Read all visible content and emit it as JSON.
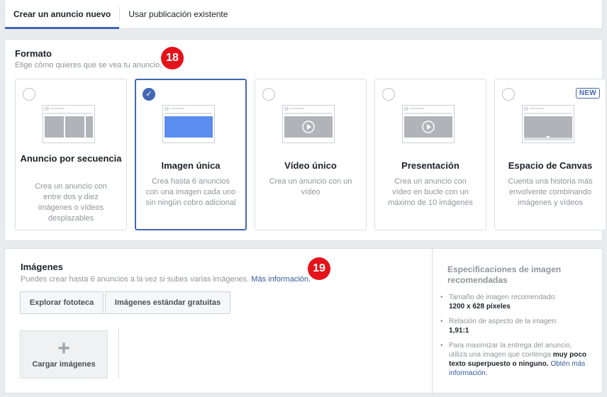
{
  "tabs": [
    {
      "label": "Crear un anuncio nuevo",
      "active": true
    },
    {
      "label": "Usar publicación existente",
      "active": false
    }
  ],
  "format": {
    "title": "Formato",
    "subtitle": "Elige cómo quieres que se vea tu anuncio.",
    "badge": "18",
    "cards": [
      {
        "title": "Anuncio por secuencia",
        "desc": "Crea un anuncio con entre dos y diez imágenes o vídeos desplazables",
        "selected": false,
        "icon": "carousel-thumbnail-icon"
      },
      {
        "title": "Imagen única",
        "desc": "Crea hasta 6 anuncios con una imagen cada uno sin ningún cobro adicional",
        "selected": true,
        "icon": "single-image-thumbnail-icon"
      },
      {
        "title": "Vídeo único",
        "desc": "Crea un anuncio con un vídeo",
        "selected": false,
        "icon": "single-video-thumbnail-icon"
      },
      {
        "title": "Presentación",
        "desc": "Crea un anuncio con vídeo en bucle con un máximo de 10 imágenes",
        "selected": false,
        "icon": "slideshow-thumbnail-icon"
      },
      {
        "title": "Espacio de Canvas",
        "desc": "Cuenta una historia más envolvente combinando imágenes y vídeos",
        "selected": false,
        "icon": "canvas-thumbnail-icon",
        "new_label": "NEW"
      }
    ]
  },
  "images": {
    "title": "Imágenes",
    "subtitle": "Puedes crear hasta 6 anuncios a la vez si subes varias imágenes.",
    "more_info": "Más información.",
    "badge": "19",
    "browse_button": "Explorar fototeca",
    "stock_button": "Imágenes estándar gratuitas",
    "upload_label": "Cargar imágenes",
    "upload_icon": "plus-icon"
  },
  "specs": {
    "title": "Especificaciones de imagen recomendadas",
    "items": [
      {
        "text": "Tamaño de imagen recomendado:",
        "value": "1200 x 628 píxeles"
      },
      {
        "text": "Relación de aspecto de la imagen:",
        "value": "1,91:1"
      },
      {
        "text": "Para maximizar la entrega del anuncio, utiliza una imagen que contenga",
        "value": "muy poco texto superpuesto o ninguno.",
        "link": "Obtén más información."
      }
    ]
  },
  "colors": {
    "accent": "#4267b2",
    "badge": "#e4131b",
    "background": "#e9ebee"
  }
}
